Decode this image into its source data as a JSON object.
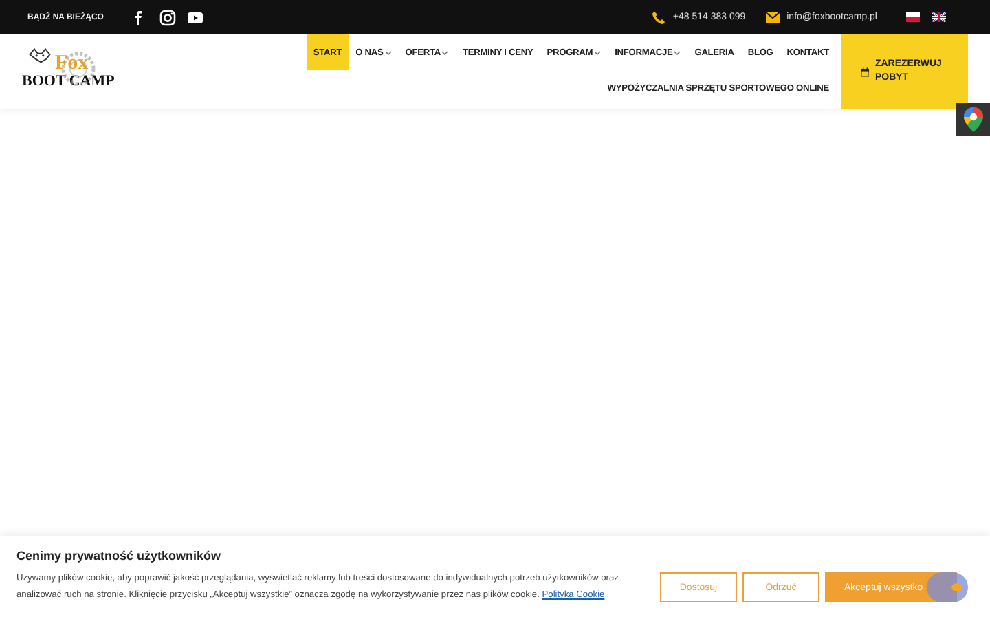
{
  "topbar": {
    "label": "BĄDŹ NA BIEŻĄCO",
    "social": [
      {
        "kind": "facebook"
      },
      {
        "kind": "instagram"
      },
      {
        "kind": "youtube"
      }
    ],
    "phone": "+48 514 383 099",
    "email": "info@foxbootcamp.pl",
    "languages": [
      {
        "kind": "pl"
      },
      {
        "kind": "en"
      }
    ]
  },
  "logo": {
    "line1": "Fox",
    "line2": "BOOT CAMP"
  },
  "nav": [
    {
      "label": "START",
      "selected": true,
      "dropdown": false
    },
    {
      "label": "O NAS",
      "selected": false,
      "dropdown": true
    },
    {
      "label": "OFERTA",
      "selected": false,
      "dropdown": true
    },
    {
      "label": "TERMINY I CENY",
      "selected": false,
      "dropdown": false
    },
    {
      "label": "PROGRAM",
      "selected": false,
      "dropdown": true
    },
    {
      "label": "INFORMACJE",
      "selected": false,
      "dropdown": true
    },
    {
      "label": "GALERIA",
      "selected": false,
      "dropdown": false
    },
    {
      "label": "BLOG",
      "selected": false,
      "dropdown": false
    },
    {
      "label": "KONTAKT",
      "selected": false,
      "dropdown": false
    },
    {
      "label": "WYPOŻYCZALNIA SPRZĘTU SPORTOWEGO ONLINE",
      "selected": false,
      "dropdown": false
    }
  ],
  "reserve_button": {
    "label": "ZAREZERWUJ POBYT"
  },
  "cookie_banner": {
    "title": "Cenimy prywatność użytkowników",
    "text": "Używamy plików cookie, aby poprawić jakość przeglądania, wyświetlać reklamy lub treści dostosowane do indywidualnych potrzeb użytkowników oraz analizować ruch na stronie. Kliknięcie przycisku „Akceptuj wszystkie” oznacza zgodę na wykorzystywanie przez nas plików cookie.",
    "link": "Polityka Cookie",
    "buttons": [
      {
        "label": "Dostosuj",
        "kind": "outline"
      },
      {
        "label": "Odrzuć",
        "kind": "outline"
      },
      {
        "label": "Akceptuj wszystko",
        "kind": "primary"
      }
    ]
  }
}
